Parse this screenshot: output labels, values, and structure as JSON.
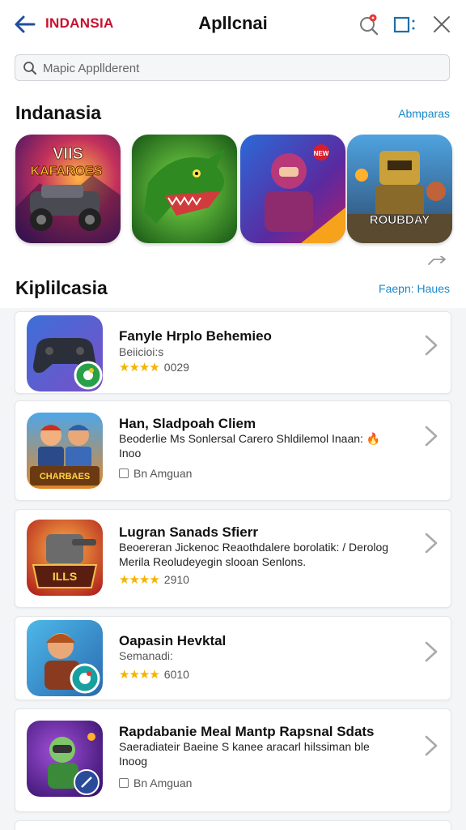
{
  "header": {
    "brand": "INDANSIA",
    "title": "Apllcnai",
    "icons": [
      "back-arrow-icon",
      "search-notification-icon",
      "window-icon",
      "close-icon"
    ]
  },
  "search": {
    "placeholder": "Mapic Appllderent"
  },
  "featured_section": {
    "title": "Indanasia",
    "link": "Abmparas",
    "apps": [
      {
        "icon_text": [
          "VIIS",
          "KAFAROES"
        ]
      },
      {
        "icon_text": []
      },
      {
        "icon_text": [
          "NEW"
        ]
      },
      {
        "icon_text": [
          "ROUBDAY"
        ]
      }
    ]
  },
  "apps_section": {
    "title": "Kiplilcasia",
    "link": "Faepn: Haues"
  },
  "apps": [
    {
      "name": "Fanyle Hrplo Behemieo",
      "subtitle": "Beiicioi:s",
      "rating_stars": 4,
      "rating_value": "0029"
    },
    {
      "name": "Han, Sladpoah Cliem",
      "description": "Beoderlie Ms Sonlersal Carero Shldilemol Inaan: 🔥 Inoo",
      "meta": "Bn Amguan",
      "icon_text": [
        "CHARBAES"
      ]
    },
    {
      "name": "Lugran Sanads Sfierr",
      "description": "Beoereran Jickenoc Reaothdalere borolatik: / Derolog Merila Reoludeyegin slooan Senlons.",
      "rating_stars": 4,
      "rating_value": "2910",
      "icon_text": [
        "ILLS"
      ]
    },
    {
      "name": "Oapasin Hevktal",
      "subtitle": "Semanadi:",
      "rating_stars": 4,
      "rating_value": "6010"
    },
    {
      "name": "Rapdabanie Meal Mantp Rapsnal Sdats",
      "description": "Saeradiateir Baeine S kanee aracarl hilssiman ble Inoog",
      "meta": "Bn Amguan"
    }
  ],
  "colors": {
    "brand": "#c8102e",
    "link": "#1a88c9",
    "star": "#f4b400",
    "notification_dot": "#e53935"
  }
}
